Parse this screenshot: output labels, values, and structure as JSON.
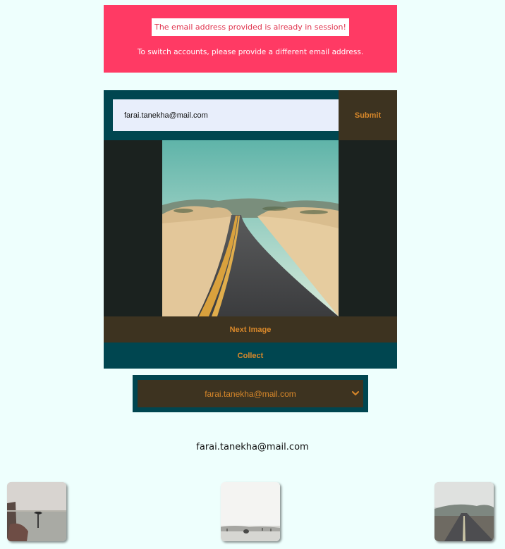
{
  "alert": {
    "message": "The email address provided is already in session!",
    "hint": "To switch accounts, please provide a different email address."
  },
  "form": {
    "email_value": "farai.tanekha@mail.com",
    "submit_label": "Submit"
  },
  "viewer": {
    "next_label": "Next Image",
    "collect_label": "Collect"
  },
  "account_select": {
    "selected": "farai.tanekha@mail.com"
  },
  "collection": {
    "email": "farai.tanekha@mail.com"
  },
  "colors": {
    "alert_bg": "#ff3a64",
    "teal": "#004650",
    "brown": "#3d3320",
    "accent": "#d9882a",
    "page_bg": "#eefffd"
  },
  "icons": {
    "select_arrow": "chevron-down-icon"
  }
}
